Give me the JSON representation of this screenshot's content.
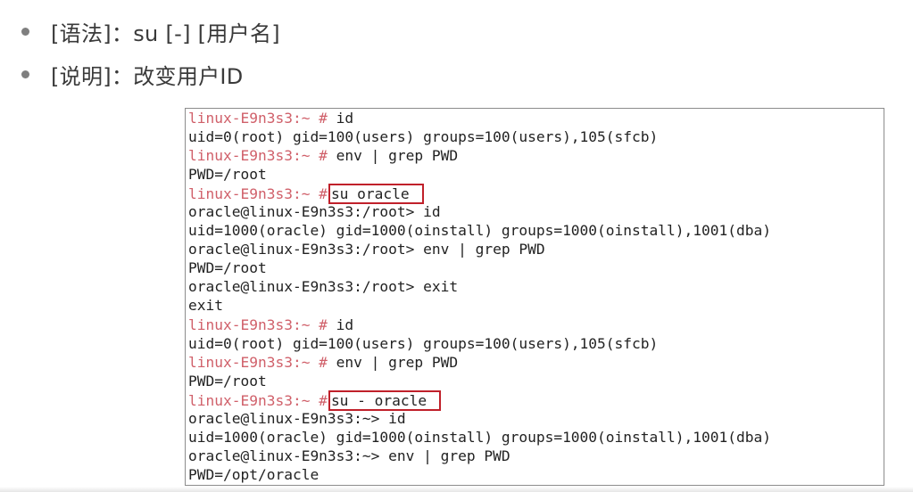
{
  "bullets": [
    {
      "text": "[语法]：su [-] [用户名]"
    },
    {
      "text": "[说明]：改变用户ID"
    }
  ],
  "terminal": {
    "lines": [
      {
        "prompt": "linux-E9n3s3:~ #",
        "cmd": " id"
      },
      {
        "text": "uid=0(root) gid=100(users) groups=100(users),105(sfcb)"
      },
      {
        "prompt": "linux-E9n3s3:~ #",
        "cmd": " env | grep PWD"
      },
      {
        "text": "PWD=/root"
      },
      {
        "prompt": "linux-E9n3s3:~ #",
        "boxed": "su oracle"
      },
      {
        "text": "oracle@linux-E9n3s3:/root> id"
      },
      {
        "text": "uid=1000(oracle) gid=1000(oinstall) groups=1000(oinstall),1001(dba)"
      },
      {
        "text": "oracle@linux-E9n3s3:/root> env | grep PWD"
      },
      {
        "text": "PWD=/root"
      },
      {
        "text": "oracle@linux-E9n3s3:/root> exit"
      },
      {
        "text": "exit"
      },
      {
        "prompt": "linux-E9n3s3:~ #",
        "cmd": " id"
      },
      {
        "text": "uid=0(root) gid=100(users) groups=100(users),105(sfcb)"
      },
      {
        "prompt": "linux-E9n3s3:~ #",
        "cmd": " env | grep PWD"
      },
      {
        "text": "PWD=/root"
      },
      {
        "prompt": "linux-E9n3s3:~ #",
        "boxed": "su - oracle"
      },
      {
        "text": "oracle@linux-E9n3s3:~> id"
      },
      {
        "text": "uid=1000(oracle) gid=1000(oinstall) groups=1000(oinstall),1001(dba)"
      },
      {
        "text": "oracle@linux-E9n3s3:~> env | grep PWD"
      },
      {
        "text": "PWD=/opt/oracle"
      }
    ]
  },
  "colors": {
    "prompt": "#d0606a",
    "highlight_box": "#c0202a",
    "bullet_text": "#3a3a3a"
  }
}
